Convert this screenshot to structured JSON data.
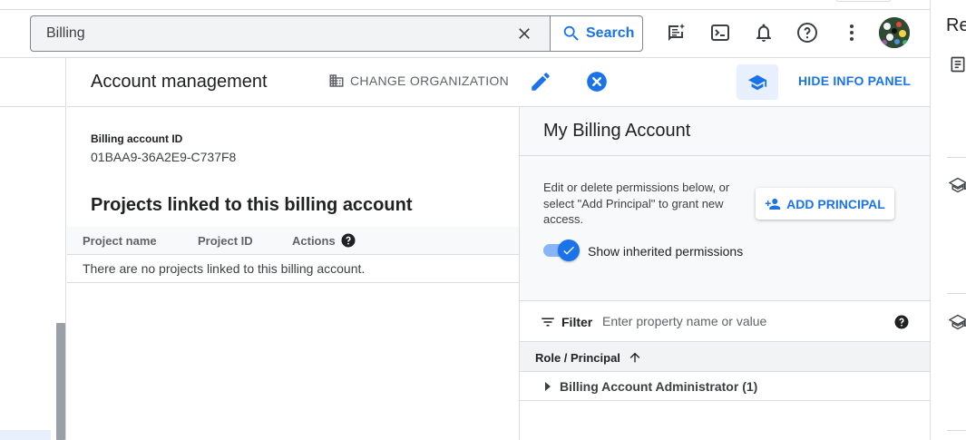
{
  "topbar": {
    "search_value": "Billing",
    "search_button": "Search",
    "icons": [
      "feedback-icon",
      "cloud-shell-icon",
      "notifications-icon",
      "help-icon",
      "more-vert-icon"
    ]
  },
  "account": {
    "title": "Account management",
    "change_org": "CHANGE ORGANIZATION",
    "hide_info": "HIDE INFO PANEL"
  },
  "main": {
    "billing_id_label": "Billing account ID",
    "billing_id_value": "01BAA9-36A2E9-C737F8",
    "projects_title": "Projects linked to this billing account",
    "columns": [
      "Project name",
      "Project ID",
      "Actions"
    ],
    "empty_message": "There are no projects linked to this billing account."
  },
  "info_panel": {
    "title": "My Billing Account",
    "description": "Edit or delete permissions below, or select \"Add Principal\" to grant new access.",
    "add_principal": "ADD PRINCIPAL",
    "show_inherited": "Show inherited permissions",
    "show_inherited_on": true,
    "filter_label": "Filter",
    "filter_placeholder": "Enter property name or value",
    "role_header": "Role / Principal",
    "role_rows": [
      "Billing Account Administrator (1)"
    ]
  },
  "right_strip": {
    "title": "Re"
  },
  "colors": {
    "accent": "#1a73e8",
    "border": "#dadce0",
    "panel_bg": "#f8f9fa"
  }
}
